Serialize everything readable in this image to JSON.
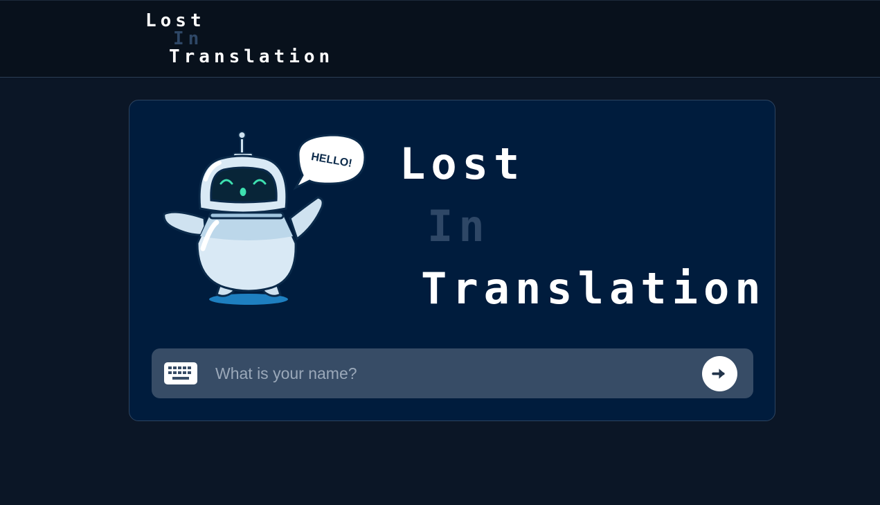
{
  "header": {
    "logo": {
      "line1": "Lost",
      "line2": "In",
      "line3": "Translation"
    }
  },
  "hero": {
    "title_line1": "Lost",
    "title_line2": "In",
    "title_line3": "Translation",
    "speech_bubble": "HELLO!"
  },
  "login": {
    "placeholder": "What is your name?",
    "value": "",
    "keyboard_icon": "keyboard-icon",
    "submit_icon": "arrow-right-icon"
  },
  "colors": {
    "background": "#0b1626",
    "header_background": "#08111c",
    "card_background": "#001c3d",
    "input_background": "#374c66",
    "accent_dim": "#2e4766",
    "text": "#ffffff"
  }
}
